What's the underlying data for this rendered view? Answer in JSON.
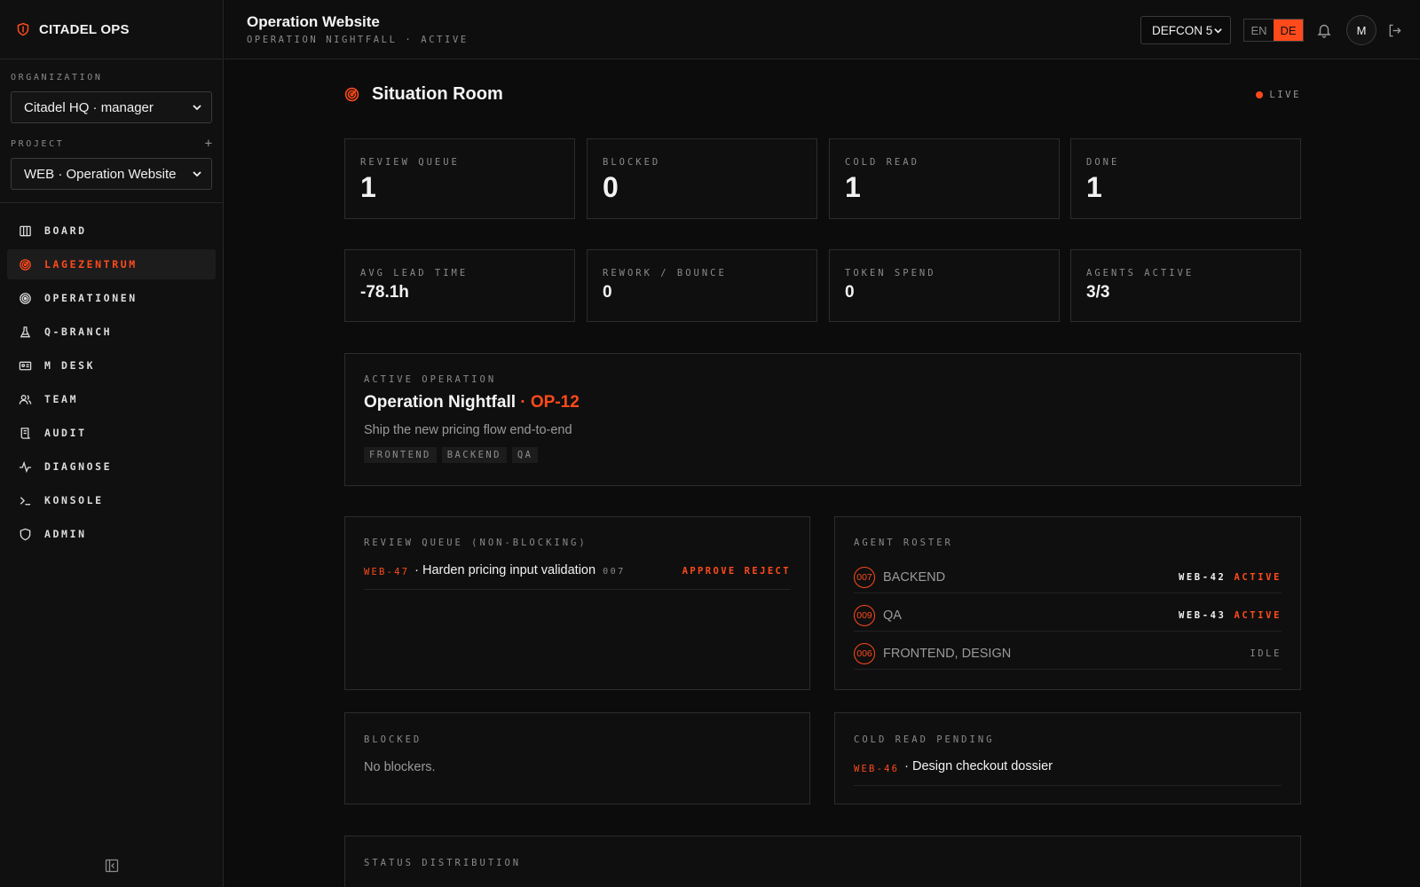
{
  "brand": {
    "name": "CITADEL OPS"
  },
  "sidebar": {
    "organization_label": "ORGANIZATION",
    "organization_value": "Citadel HQ · manager",
    "project_label": "PROJECT",
    "project_add": "+",
    "project_value": "WEB · Operation Website",
    "items": [
      {
        "label": "BOARD",
        "icon": "board-icon"
      },
      {
        "label": "LAGEZENTRUM",
        "icon": "radar-icon",
        "active": true
      },
      {
        "label": "OPERATIONEN",
        "icon": "target-icon"
      },
      {
        "label": "Q-BRANCH",
        "icon": "flask-icon"
      },
      {
        "label": "M DESK",
        "icon": "id-card-icon"
      },
      {
        "label": "TEAM",
        "icon": "users-icon"
      },
      {
        "label": "AUDIT",
        "icon": "scroll-icon"
      },
      {
        "label": "DIAGNOSE",
        "icon": "pulse-icon"
      },
      {
        "label": "KONSOLE",
        "icon": "terminal-icon"
      },
      {
        "label": "ADMIN",
        "icon": "shield-icon"
      }
    ]
  },
  "header": {
    "title": "Operation Website",
    "subtitle": "OPERATION NIGHTFALL · ACTIVE",
    "defcon": "DEFCON 5",
    "lang_en": "EN",
    "lang_de": "DE",
    "avatar_initial": "M"
  },
  "room": {
    "title": "Situation Room",
    "live": "LIVE"
  },
  "stats_top": [
    {
      "label": "REVIEW QUEUE",
      "value": "1"
    },
    {
      "label": "BLOCKED",
      "value": "0"
    },
    {
      "label": "COLD READ",
      "value": "1"
    },
    {
      "label": "DONE",
      "value": "1"
    }
  ],
  "stats_bottom": [
    {
      "label": "AVG LEAD TIME",
      "value": "-78.1h"
    },
    {
      "label": "REWORK / BOUNCE",
      "value": "0"
    },
    {
      "label": "TOKEN SPEND",
      "value": "0"
    },
    {
      "label": "AGENTS ACTIVE",
      "value": "3/3"
    }
  ],
  "operation": {
    "label": "ACTIVE OPERATION",
    "name": "Operation Nightfall",
    "code": "· OP-12",
    "description": "Ship the new pricing flow end-to-end",
    "tags": [
      "FRONTEND",
      "BACKEND",
      "QA"
    ]
  },
  "review_queue": {
    "label": "REVIEW QUEUE (NON-BLOCKING)",
    "items": [
      {
        "id": "WEB-47",
        "title": "· Harden pricing input validation",
        "agent": "007",
        "approve": "APPROVE",
        "reject": "REJECT"
      }
    ]
  },
  "agent_roster": {
    "label": "AGENT ROSTER",
    "agents": [
      {
        "num": "007",
        "role": "BACKEND",
        "ticket": "WEB-42",
        "status": "ACTIVE"
      },
      {
        "num": "009",
        "role": "QA",
        "ticket": "WEB-43",
        "status": "ACTIVE"
      },
      {
        "num": "006",
        "role": "FRONTEND, DESIGN",
        "ticket": "",
        "status": "IDLE"
      }
    ]
  },
  "blocked": {
    "label": "BLOCKED",
    "empty": "No blockers."
  },
  "cold_read": {
    "label": "COLD READ PENDING",
    "items": [
      {
        "id": "WEB-46",
        "title": "· Design checkout dossier"
      }
    ]
  },
  "status_distribution": {
    "label": "STATUS DISTRIBUTION"
  },
  "colors": {
    "accent": "#ff4a1c",
    "background": "#0c0c0c",
    "border": "#2c2c2c"
  }
}
